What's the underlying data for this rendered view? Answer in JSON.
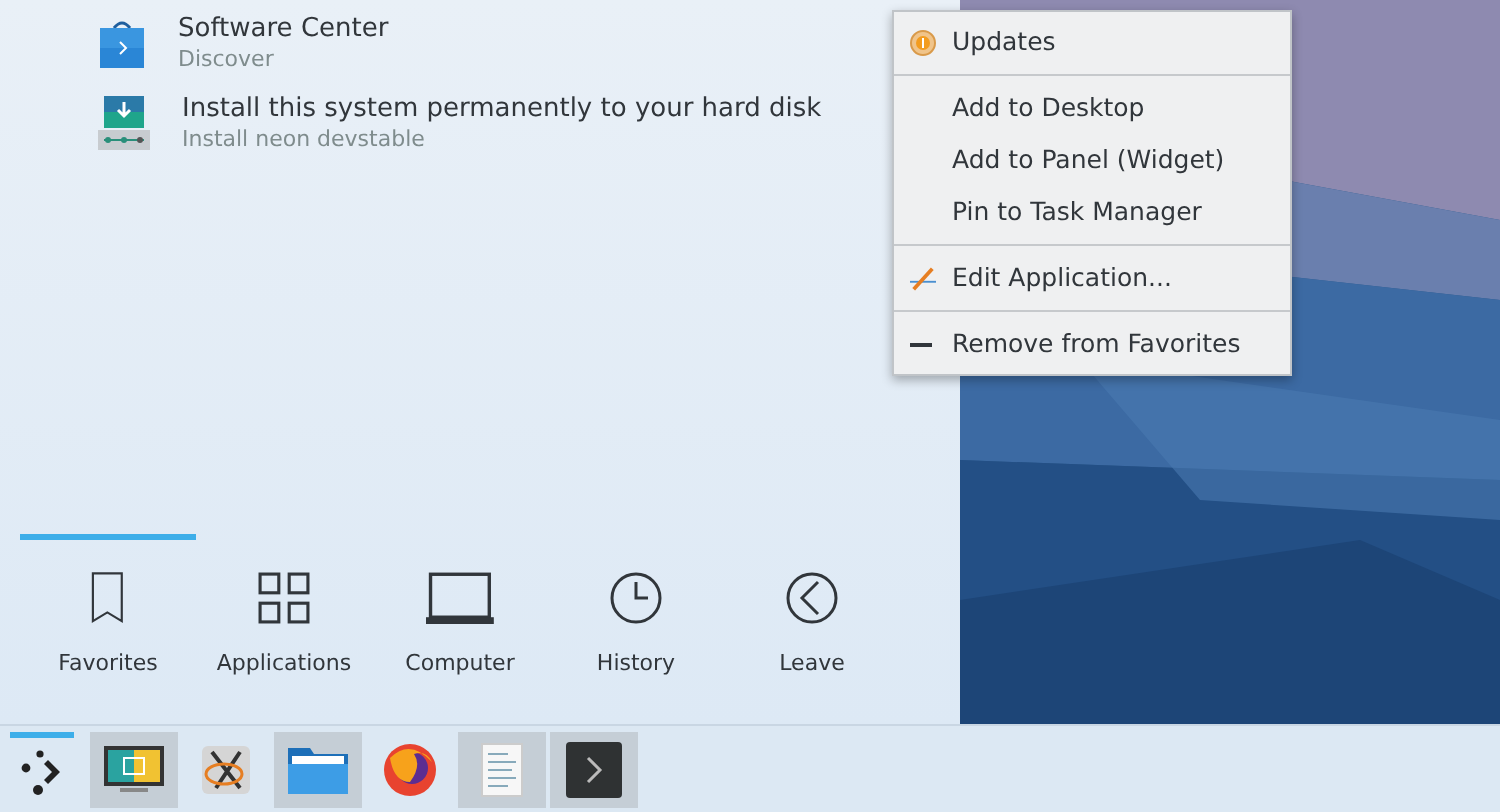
{
  "favorites": [
    {
      "title": "Software Center",
      "subtitle": "Discover"
    },
    {
      "title": "Install this system permanently to your hard disk",
      "subtitle": "Install neon devstable"
    }
  ],
  "context_menu": [
    {
      "kind": "item",
      "label": "Updates"
    },
    {
      "kind": "separator"
    },
    {
      "kind": "item",
      "label": "Add to Desktop"
    },
    {
      "kind": "item",
      "label": "Add to Panel (Widget)"
    },
    {
      "kind": "item",
      "label": "Pin to Task Manager"
    },
    {
      "kind": "separator"
    },
    {
      "kind": "item",
      "label": "Edit Application..."
    },
    {
      "kind": "separator"
    },
    {
      "kind": "item",
      "label": "Remove from Favorites"
    }
  ],
  "tabs": [
    {
      "label": "Favorites",
      "selected": true
    },
    {
      "label": "Applications",
      "selected": false
    },
    {
      "label": "Computer",
      "selected": false
    },
    {
      "label": "History",
      "selected": false
    },
    {
      "label": "Leave",
      "selected": false
    }
  ],
  "taskbar": [
    {
      "kind": "launcher",
      "active": true
    },
    {
      "kind": "task",
      "running": true
    },
    {
      "kind": "task",
      "running": false
    },
    {
      "kind": "task",
      "running": true
    },
    {
      "kind": "task",
      "running": false
    },
    {
      "kind": "task",
      "running": true
    },
    {
      "kind": "task",
      "running": true
    }
  ]
}
